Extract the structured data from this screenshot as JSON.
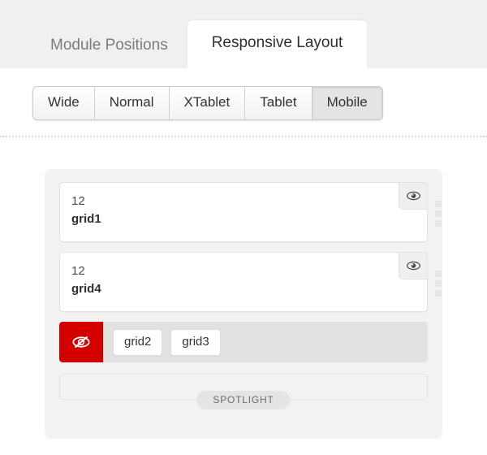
{
  "tabs": [
    {
      "label": "Module Positions",
      "active": false
    },
    {
      "label": "Responsive Layout",
      "active": true
    }
  ],
  "devices": [
    {
      "label": "Wide",
      "active": false
    },
    {
      "label": "Normal",
      "active": false
    },
    {
      "label": "XTablet",
      "active": false
    },
    {
      "label": "Tablet",
      "active": false
    },
    {
      "label": "Mobile",
      "active": true
    }
  ],
  "panel": {
    "rows": [
      {
        "span": "12",
        "name": "grid1",
        "visibility_icon": "eye-visible-icon",
        "drag_handle_icon": "drag-handle-icon"
      },
      {
        "span": "12",
        "name": "grid4",
        "visibility_icon": "eye-visible-icon",
        "drag_handle_icon": "drag-handle-icon"
      }
    ],
    "hidden_row": {
      "visibility_icon": "eye-hidden-icon",
      "accent_color": "#d40000",
      "chips": [
        {
          "label": "grid2"
        },
        {
          "label": "grid3"
        }
      ]
    },
    "spotlight": {
      "label": "SPOTLIGHT"
    }
  }
}
